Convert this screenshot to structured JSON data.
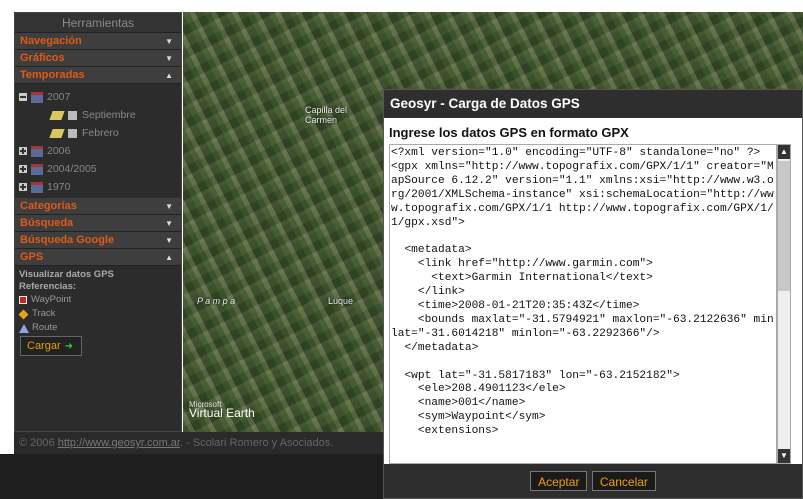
{
  "panel": {
    "title": "Herramientas",
    "sections": {
      "navegacion": "Navegación",
      "graficos": "Gráficos",
      "temporadas": "Temporadas",
      "categorias": "Categorías",
      "busqueda": "Búsqueda",
      "busqueda_google": "Búsqueda Google",
      "gps": "GPS"
    },
    "tree": {
      "y2007": "2007",
      "septiembre": "Septiembre",
      "febrero": "Febrero",
      "y2006": "2006",
      "y2004": "2004/2005",
      "y1970": "1970"
    },
    "gps": {
      "heading": "Visualizar datos GPS",
      "refs_label": "Referencias:",
      "waypoint": "WayPoint",
      "track": "Track",
      "route": "Route",
      "load_button": "Cargar"
    }
  },
  "map": {
    "label_capilla": "Capilla del\nCarmen",
    "label_pampa": "P a m p a",
    "label_luque": "Luque",
    "ms_line1": "Microsoft",
    "ms_line2": "Virtual Earth"
  },
  "footer": {
    "prefix": "© 2006 ",
    "link": "http://www.geosyr.com.ar",
    "suffix": ". - Scolari Romero y Asociados."
  },
  "dialog": {
    "title": "Geosyr - Carga de Datos GPS",
    "label": "Ingrese los datos GPS en formato GPX",
    "gpx_text": "<?xml version=\"1.0\" encoding=\"UTF-8\" standalone=\"no\" ?>\n<gpx xmlns=\"http://www.topografix.com/GPX/1/1\" creator=\"MapSource 6.12.2\" version=\"1.1\" xmlns:xsi=\"http://www.w3.org/2001/XMLSchema-instance\" xsi:schemaLocation=\"http://www.topografix.com/GPX/1/1 http://www.topografix.com/GPX/1/1/gpx.xsd\">\n\n  <metadata>\n    <link href=\"http://www.garmin.com\">\n      <text>Garmin International</text>\n    </link>\n    <time>2008-01-21T20:35:43Z</time>\n    <bounds maxlat=\"-31.5794921\" maxlon=\"-63.2122636\" minlat=\"-31.6014218\" minlon=\"-63.2292366\"/>\n  </metadata>\n\n  <wpt lat=\"-31.5817183\" lon=\"-63.2152182\">\n    <ele>208.4901123</ele>\n    <name>001</name>\n    <sym>Waypoint</sym>\n    <extensions>",
    "accept": "Aceptar",
    "cancel": "Cancelar"
  }
}
